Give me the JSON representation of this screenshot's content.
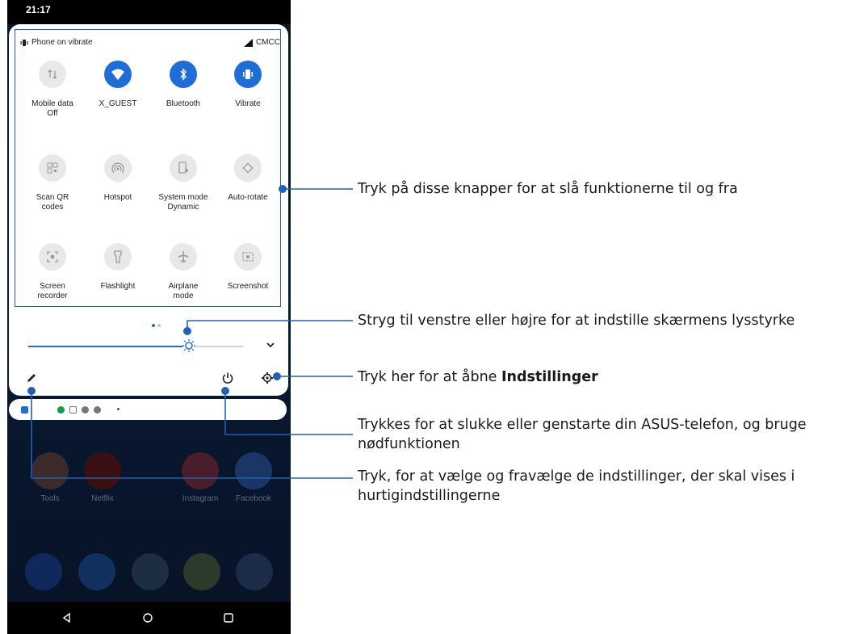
{
  "status_bar": {
    "time": "21:17"
  },
  "quick_settings": {
    "vibrate_status": "Phone on vibrate",
    "carrier": "CMCC",
    "tiles": [
      {
        "label": "Mobile data",
        "sublabel": "Off",
        "icon": "mobile-data-icon",
        "active": false
      },
      {
        "label": "X_GUEST",
        "sublabel": "",
        "icon": "wifi-icon",
        "active": true
      },
      {
        "label": "Bluetooth",
        "sublabel": "",
        "icon": "bluetooth-icon",
        "active": true
      },
      {
        "label": "Vibrate",
        "sublabel": "",
        "icon": "vibrate-icon",
        "active": true
      },
      {
        "label": "Scan QR",
        "sublabel": "codes",
        "icon": "qr-icon",
        "active": false
      },
      {
        "label": "Hotspot",
        "sublabel": "",
        "icon": "hotspot-icon",
        "active": false
      },
      {
        "label": "System mode",
        "sublabel": "Dynamic",
        "icon": "system-mode-icon",
        "active": false
      },
      {
        "label": "Auto-rotate",
        "sublabel": "",
        "icon": "auto-rotate-icon",
        "active": false
      },
      {
        "label": "Screen",
        "sublabel": "recorder",
        "icon": "screen-recorder-icon",
        "active": false
      },
      {
        "label": "Flashlight",
        "sublabel": "",
        "icon": "flashlight-icon",
        "active": false
      },
      {
        "label": "Airplane",
        "sublabel": "mode",
        "icon": "airplane-icon",
        "active": false
      },
      {
        "label": "Screenshot",
        "sublabel": "",
        "icon": "screenshot-icon",
        "active": false
      }
    ],
    "brightness_level": 0.75
  },
  "home_screen": {
    "apps": [
      {
        "label": "Tools",
        "color": "#3a2a2a"
      },
      {
        "label": "Netflix",
        "color": "#3a0f12"
      },
      {
        "label": "Instagram",
        "color": "#4a1d2a"
      },
      {
        "label": "Facebook",
        "color": "#1a3566"
      }
    ]
  },
  "callouts": {
    "toggle": "Tryk på disse knapper for at slå funktionerne til og fra",
    "brightness": "Stryg til venstre eller højre for at indstille skærmens lysstyrke",
    "settings_prefix": "Tryk her for at åbne ",
    "settings_bold": "Indstillinger",
    "power_line1": "Trykkes for at slukke eller genstarte din ASUS-telefon, og bruge",
    "power_line2": "nødfunktionen",
    "edit_line1": "Tryk, for at vælge og fravælge de indstillinger, der skal vises i",
    "edit_line2": "hurtigindstillingerne"
  },
  "colors": {
    "accent": "#1f6ed8",
    "callout_line": "#1f62b3"
  }
}
